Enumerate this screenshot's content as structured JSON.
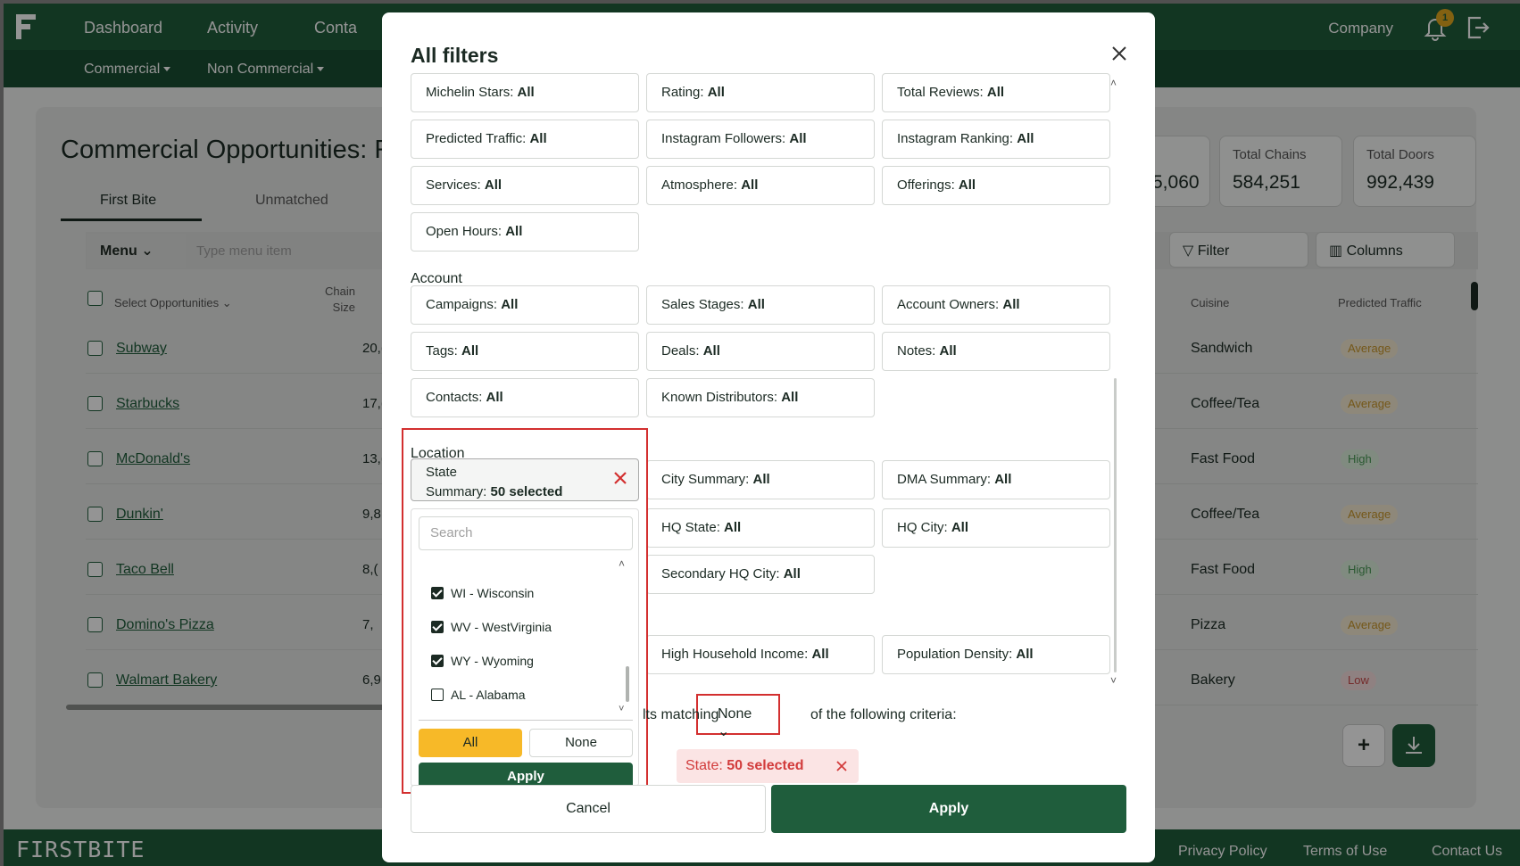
{
  "nav": {
    "items": [
      "Dashboard",
      "Activity",
      "Conta"
    ],
    "subitems": [
      "Commercial",
      "Non Commercial"
    ],
    "company": "Company",
    "notification_count": "1"
  },
  "background": {
    "title": "Commercial Opportunities: R",
    "tabs": [
      "First Bite",
      "Unmatched"
    ],
    "stats": [
      {
        "label": "",
        "value": "5,060"
      },
      {
        "label": "Total Chains",
        "value": "584,251"
      },
      {
        "label": "Total Doors",
        "value": "992,439"
      }
    ],
    "menu_select": "Menu",
    "menu_placeholder": "Type menu item",
    "filter_label": "Filter",
    "columns_label": "Columns",
    "col_select": "Select Opportunities",
    "col_chain_a": "Chain",
    "col_chain_b": "Size",
    "col_cuisine": "Cuisine",
    "col_traffic": "Predicted Traffic",
    "rows": [
      {
        "name": "Subway",
        "size": "20,(",
        "cuisine": "Sandwich",
        "traffic": "Average"
      },
      {
        "name": "Starbucks",
        "size": "17,(",
        "cuisine": "Coffee/Tea",
        "traffic": "Average"
      },
      {
        "name": "McDonald's",
        "size": "13,(",
        "cuisine": "Fast Food",
        "traffic": "High"
      },
      {
        "name": "Dunkin'",
        "size": "9,8",
        "cuisine": "Coffee/Tea",
        "traffic": "Average"
      },
      {
        "name": "Taco Bell",
        "size": "8,(",
        "cuisine": "Fast Food",
        "traffic": "High"
      },
      {
        "name": "Domino's Pizza",
        "size": "7,",
        "cuisine": "Pizza",
        "traffic": "Average"
      },
      {
        "name": "Walmart Bakery",
        "size": "6,9",
        "cuisine": "Bakery",
        "traffic": "Low"
      }
    ],
    "plus_label": "+"
  },
  "footer": {
    "brand": "FIRSTBITE",
    "links": [
      "Privacy Policy",
      "Terms of Use",
      "Contact Us"
    ]
  },
  "modal": {
    "title": "All filters",
    "row1": [
      {
        "label": "Michelin Stars: ",
        "value": "All"
      },
      {
        "label": "Rating: ",
        "value": "All"
      },
      {
        "label": "Total Reviews: ",
        "value": "All"
      }
    ],
    "row2": [
      {
        "label": "Predicted Traffic: ",
        "value": "All"
      },
      {
        "label": "Instagram Followers: ",
        "value": "All"
      },
      {
        "label": "Instagram Ranking: ",
        "value": "All"
      }
    ],
    "row3": [
      {
        "label": "Services: ",
        "value": "All"
      },
      {
        "label": "Atmosphere: ",
        "value": "All"
      },
      {
        "label": "Offerings: ",
        "value": "All"
      }
    ],
    "row4": [
      {
        "label": "Open Hours: ",
        "value": "All"
      }
    ],
    "account_label": "Account",
    "account1": [
      {
        "label": "Campaigns: ",
        "value": "All"
      },
      {
        "label": "Sales Stages: ",
        "value": "All"
      },
      {
        "label": "Account Owners: ",
        "value": "All"
      }
    ],
    "account2": [
      {
        "label": "Tags: ",
        "value": "All"
      },
      {
        "label": "Deals: ",
        "value": "All"
      },
      {
        "label": "Notes: ",
        "value": "All"
      }
    ],
    "account3": [
      {
        "label": "Contacts: ",
        "value": "All"
      },
      {
        "label": "Known Distributors: ",
        "value": "All"
      }
    ],
    "location_label": "Location",
    "state": {
      "line1": "State",
      "line2": "Summary: ",
      "value": "50 selected"
    },
    "location1": [
      {
        "label": "City Summary: ",
        "value": "All"
      },
      {
        "label": "DMA Summary: ",
        "value": "All"
      }
    ],
    "location2": [
      {
        "label": "HQ State: ",
        "value": "All"
      },
      {
        "label": "HQ City: ",
        "value": "All"
      }
    ],
    "location3": [
      {
        "label": "Secondary HQ City: ",
        "value": "All"
      }
    ],
    "demo": [
      {
        "label": "High Household Income: ",
        "value": "All"
      },
      {
        "label": "Population Density: ",
        "value": "All"
      }
    ],
    "dropdown": {
      "search_placeholder": "Search",
      "items": [
        {
          "label": "WI - Wisconsin",
          "checked": true
        },
        {
          "label": "WV - WestVirginia",
          "checked": true
        },
        {
          "label": "WY - Wyoming",
          "checked": true
        },
        {
          "label": "AL - Alabama",
          "checked": false
        }
      ],
      "all_label": "All",
      "none_label": "None",
      "apply_label": "Apply"
    },
    "match_prefix": "lts matching",
    "match_value": "None",
    "match_suffix": "of the following criteria:",
    "chip": {
      "label": "State: ",
      "value": "50 selected"
    },
    "cancel_label": "Cancel",
    "apply_label": "Apply"
  },
  "colors": {
    "brand_green": "#1f5d3c",
    "accent_yellow": "#f7b928",
    "highlight_red": "#d32f2f"
  }
}
